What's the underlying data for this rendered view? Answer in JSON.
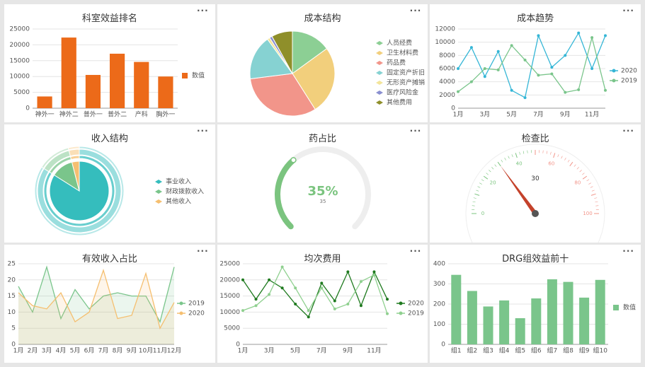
{
  "menu_label": "···",
  "colors": {
    "orange": "#ec6a19",
    "blue": "#35b6d6",
    "green": "#7ac58b",
    "darkgreen": "#2e8b2e",
    "lightgreen": "#8fd08f",
    "peach": "#f5bf70",
    "gauge_green": "#7bc47f",
    "gauge_track": "#eeeeee"
  },
  "cards": [
    {
      "title": "科室效益排名"
    },
    {
      "title": "成本结构"
    },
    {
      "title": "成本趋势"
    },
    {
      "title": "收入结构"
    },
    {
      "title": "药占比"
    },
    {
      "title": "检查比"
    },
    {
      "title": "有效收入占比"
    },
    {
      "title": "均次费用"
    },
    {
      "title": "DRG组效益前十"
    }
  ],
  "chart_data": [
    {
      "type": "bar",
      "title": "科室效益排名",
      "categories": [
        "神外一",
        "神外二",
        "普外一",
        "普外二",
        "产科",
        "胸外一"
      ],
      "series": [
        {
          "name": "数值",
          "values": [
            3700,
            22300,
            10500,
            17200,
            14600,
            10000
          ]
        }
      ],
      "ylim": [
        0,
        25000
      ],
      "yticks": [
        "0",
        "5000",
        "10000",
        "15000",
        "20000",
        "25000"
      ],
      "legend": "right",
      "grid": true
    },
    {
      "type": "pie",
      "title": "成本结构",
      "slices": [
        {
          "name": "人员经费",
          "value": 15,
          "color": "#8ccf94"
        },
        {
          "name": "卫生材料费",
          "value": 26,
          "color": "#f2cf7c"
        },
        {
          "name": "药品费",
          "value": 32,
          "color": "#f2958a"
        },
        {
          "name": "固定资产折旧",
          "value": 17,
          "color": "#86d2d2"
        },
        {
          "name": "无形资产摊销",
          "value": 1,
          "color": "#f3e59a"
        },
        {
          "name": "医疗风险金",
          "value": 1,
          "color": "#8a8fd0"
        },
        {
          "name": "其他费用",
          "value": 8,
          "color": "#8f8f2a"
        }
      ],
      "legend": "right"
    },
    {
      "type": "line",
      "title": "成本趋势",
      "x": [
        "1月",
        "2月",
        "3月",
        "4月",
        "5月",
        "6月",
        "7月",
        "8月",
        "9月",
        "10月",
        "11月",
        "12月"
      ],
      "xticks": [
        "1月",
        "3月",
        "5月",
        "7月",
        "9月",
        "11月"
      ],
      "series": [
        {
          "name": "2020",
          "color": "#35b6d6",
          "values": [
            6000,
            9200,
            4800,
            8600,
            2700,
            1600,
            11000,
            6200,
            8000,
            11400,
            6000,
            11000
          ]
        },
        {
          "name": "2019",
          "color": "#7ac58b",
          "values": [
            2500,
            4000,
            6000,
            5800,
            9500,
            7300,
            5000,
            5200,
            2400,
            2800,
            10700,
            2700
          ]
        }
      ],
      "ylim": [
        0,
        12000
      ],
      "yticks": [
        "0",
        "2000",
        "4000",
        "6000",
        "8000",
        "10000",
        "12000"
      ],
      "legend": "right",
      "grid": true
    },
    {
      "type": "pie",
      "title": "收入结构",
      "style": "nested-donut",
      "slices": [
        {
          "name": "事业收入",
          "value": 84,
          "color": "#35bdbd"
        },
        {
          "name": "财政拨款收入",
          "value": 12,
          "color": "#7ac58b"
        },
        {
          "name": "其他收入",
          "value": 4,
          "color": "#f5bf70"
        }
      ],
      "legend": "right"
    },
    {
      "type": "gauge",
      "title": "药占比",
      "value": 35,
      "label": "35%",
      "sublabel": "35",
      "max": 100
    },
    {
      "type": "gauge",
      "title": "检查比",
      "value": 30,
      "label": "30",
      "min": 0,
      "max": 100,
      "ticks": [
        "0",
        "20",
        "40",
        "60",
        "80",
        "100"
      ]
    },
    {
      "type": "area",
      "title": "有效收入占比",
      "x": [
        "1月",
        "2月",
        "3月",
        "4月",
        "5月",
        "6月",
        "7月",
        "8月",
        "9月",
        "10月",
        "11月",
        "12月"
      ],
      "series": [
        {
          "name": "2019",
          "color": "#7ac58b",
          "values": [
            18,
            10,
            24,
            8,
            17,
            11,
            15,
            16,
            15,
            15,
            7,
            24
          ]
        },
        {
          "name": "2020",
          "color": "#f5bf70",
          "values": [
            16,
            12,
            11,
            16,
            7,
            10,
            23,
            8,
            9,
            22,
            5,
            13
          ]
        }
      ],
      "ylim": [
        0,
        25
      ],
      "yticks": [
        "0",
        "5",
        "10",
        "15",
        "20",
        "25"
      ],
      "legend": "right",
      "grid": true
    },
    {
      "type": "line",
      "title": "均次费用",
      "x": [
        "1月",
        "2月",
        "3月",
        "4月",
        "5月",
        "6月",
        "7月",
        "8月",
        "9月",
        "10月",
        "11月",
        "12月"
      ],
      "xticks": [
        "1月",
        "3月",
        "5月",
        "7月",
        "9月",
        "11月"
      ],
      "series": [
        {
          "name": "2020",
          "color": "#1f7a1f",
          "values": [
            20000,
            14000,
            20000,
            17500,
            12500,
            8500,
            19000,
            13500,
            22500,
            12000,
            22500,
            14000
          ]
        },
        {
          "name": "2019",
          "color": "#8fd08f",
          "values": [
            10500,
            12000,
            15500,
            24000,
            17500,
            10500,
            17500,
            11000,
            12500,
            19500,
            21500,
            9500
          ]
        }
      ],
      "ylim": [
        0,
        25000
      ],
      "yticks": [
        "0",
        "5000",
        "10000",
        "15000",
        "20000",
        "25000"
      ],
      "legend": "right",
      "grid": true
    },
    {
      "type": "bar",
      "title": "DRG组效益前十",
      "categories": [
        "组1",
        "组2",
        "组3",
        "组4",
        "组5",
        "组6",
        "组7",
        "组8",
        "组9",
        "组10"
      ],
      "series": [
        {
          "name": "数值",
          "values": [
            345,
            265,
            188,
            218,
            130,
            228,
            323,
            310,
            232,
            320
          ]
        }
      ],
      "ylim": [
        0,
        400
      ],
      "yticks": [
        "0",
        "100",
        "200",
        "300",
        "400"
      ],
      "legend": "right",
      "grid": true
    }
  ]
}
